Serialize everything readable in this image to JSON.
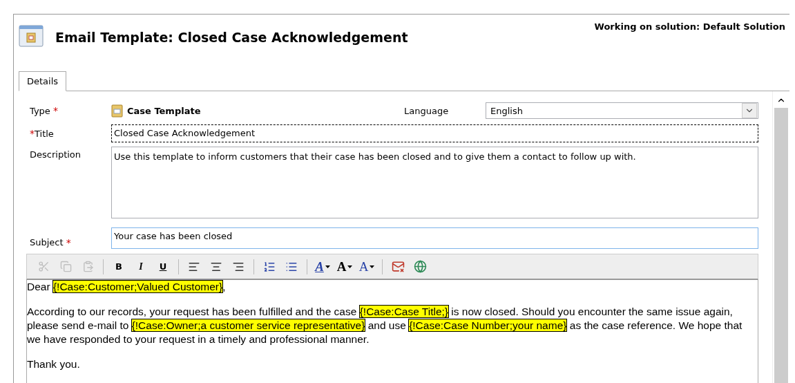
{
  "header": {
    "title": "Email Template: Closed Case Acknowledgement",
    "solution": "Working on solution: Default Solution"
  },
  "tabs": [
    {
      "label": "Details",
      "selected": true
    }
  ],
  "form": {
    "type": {
      "label": "Type",
      "required_mark": "*",
      "value": "Case Template"
    },
    "language": {
      "label": "Language",
      "value": "English"
    },
    "title": {
      "label": "Title",
      "required_mark": "*",
      "value": "Closed Case Acknowledgement",
      "focused": true
    },
    "description": {
      "label": "Description",
      "value": "Use this template to inform customers that their case has been closed and to give them a contact to follow up with."
    },
    "subject": {
      "label": "Subject",
      "required_mark": "*",
      "value": "Your case has been closed"
    }
  },
  "toolbar": [
    {
      "kind": "cut",
      "disabled": true
    },
    {
      "kind": "copy",
      "disabled": true
    },
    {
      "kind": "paste",
      "disabled": true
    },
    {
      "kind": "separator"
    },
    {
      "kind": "bold",
      "label": "B",
      "disabled": false
    },
    {
      "kind": "italic",
      "label": "I",
      "disabled": false
    },
    {
      "kind": "underline",
      "label": "U",
      "disabled": false
    },
    {
      "kind": "separator"
    },
    {
      "kind": "align-left",
      "disabled": false
    },
    {
      "kind": "align-center",
      "disabled": false
    },
    {
      "kind": "align-right",
      "disabled": false
    },
    {
      "kind": "separator"
    },
    {
      "kind": "numbered-list",
      "disabled": false
    },
    {
      "kind": "bulleted-list",
      "disabled": false
    },
    {
      "kind": "separator"
    },
    {
      "kind": "highlight",
      "label": "A",
      "disabled": false
    },
    {
      "kind": "font-size",
      "label": "A",
      "disabled": false
    },
    {
      "kind": "font-color",
      "label": "A",
      "disabled": false
    },
    {
      "kind": "separator"
    },
    {
      "kind": "remove-link",
      "disabled": false
    },
    {
      "kind": "insert-link",
      "disabled": false
    }
  ],
  "body": [
    [
      {
        "kind": "text",
        "text": "Dear "
      },
      {
        "kind": "field",
        "text": "{!Case:Customer;Valued Customer}"
      },
      {
        "kind": "text",
        "text": ","
      }
    ],
    [
      {
        "kind": "text",
        "text": "According to our records, your request has been fulfilled and the case "
      },
      {
        "kind": "field",
        "text": "{!Case:Case Title;}"
      },
      {
        "kind": "text",
        "text": " is now closed. Should you encounter the same issue again, please send e-mail to "
      },
      {
        "kind": "field",
        "text": "{!Case:Owner;a customer service representative}"
      },
      {
        "kind": "text",
        "text": " and use "
      },
      {
        "kind": "field",
        "text": "{!Case:Case Number;your name}"
      },
      {
        "kind": "text",
        "text": " as the case reference. We hope that we have responded to your request in a timely and professional manner."
      }
    ],
    [
      {
        "kind": "text",
        "text": "Thank you."
      }
    ]
  ]
}
